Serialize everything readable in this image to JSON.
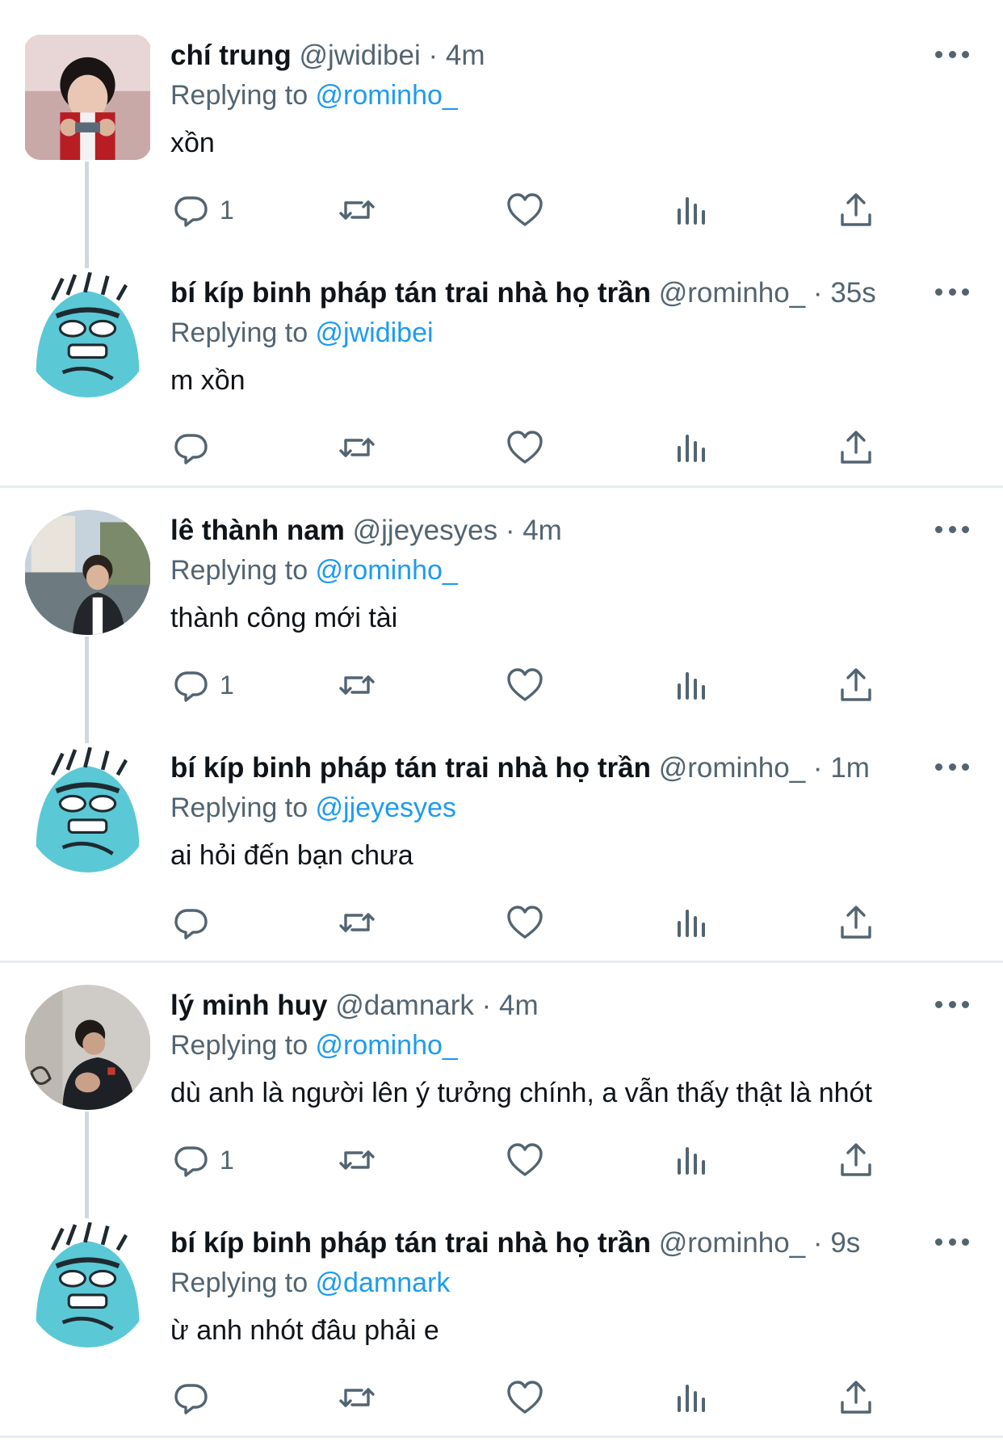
{
  "colors": {
    "text": "#0f1419",
    "muted": "#536471",
    "mention": "#1d9bf0",
    "divider": "#e6ecf0",
    "thread_line": "#cfd9de"
  },
  "icons": [
    "reply-icon",
    "retweet-icon",
    "like-icon",
    "views-icon",
    "share-icon",
    "more-icon"
  ],
  "threads": [
    {
      "tweets": [
        {
          "name": "chí trung",
          "handle": "@jwidibei",
          "dot": "·",
          "time": "4m",
          "replying_prefix": "Replying to ",
          "replying_to": "@rominho_",
          "text": "xồn",
          "reply_count": "1"
        },
        {
          "name": "bí kíp binh pháp tán trai nhà họ trần",
          "handle": "@rominho_",
          "dot": "·",
          "time": "35s",
          "replying_prefix": "Replying to ",
          "replying_to": "@jwidibei",
          "text": "m xồn",
          "reply_count": ""
        }
      ]
    },
    {
      "tweets": [
        {
          "name": "lê thành nam",
          "handle": "@jjeyesyes",
          "dot": "·",
          "time": "4m",
          "replying_prefix": "Replying to ",
          "replying_to": "@rominho_",
          "text": "thành công mới tài",
          "reply_count": "1"
        },
        {
          "name": "bí kíp binh pháp tán trai nhà họ trần",
          "handle": "@rominho_",
          "dot": "·",
          "time": "1m",
          "replying_prefix": "Replying to ",
          "replying_to": "@jjeyesyes",
          "text": "ai hỏi đến bạn chưa",
          "reply_count": ""
        }
      ]
    },
    {
      "tweets": [
        {
          "name": "lý minh huy",
          "handle": "@damnark",
          "dot": "·",
          "time": "4m",
          "replying_prefix": "Replying to ",
          "replying_to": "@rominho_",
          "text": "dù anh là người lên ý tưởng chính, a vẫn thấy thật là nhót",
          "reply_count": "1"
        },
        {
          "name": "bí kíp binh pháp tán trai nhà họ trần",
          "handle": "@rominho_",
          "dot": "·",
          "time": "9s",
          "replying_prefix": "Replying to ",
          "replying_to": "@damnark",
          "text": "ừ anh nhót đâu phải e",
          "reply_count": ""
        }
      ]
    }
  ]
}
